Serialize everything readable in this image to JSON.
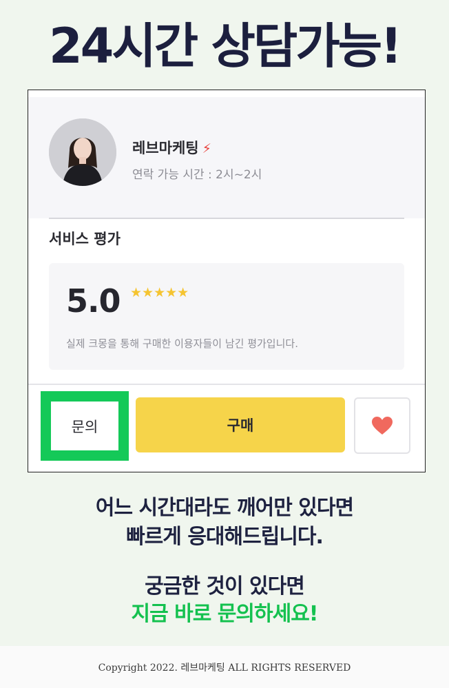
{
  "headline": "24시간 상담가능!",
  "seller": {
    "name": "레브마케팅",
    "badge_icon": "lightning-bolt-icon",
    "contact_time": "연락 가능 시간 : 2시~2시"
  },
  "rating": {
    "title": "서비스 평가",
    "score": "5.0",
    "stars": "★★★★★",
    "description": "실제 크몽을 통해 구매한 이용자들이 남긴 평가입니다."
  },
  "actions": {
    "inquiry_label": "문의",
    "buy_label": "구매",
    "like_icon": "heart-icon"
  },
  "message": {
    "line1": "어느 시간대라도 깨어만 있다면",
    "line2": "빠르게 응대해드립니다.",
    "line3": "궁금한 것이 있다면",
    "line4": "지금 바로 문의하세요!"
  },
  "footer": {
    "copyright": "Copyright 2022. 레브마케팅 ALL RIGHTS RESERVED"
  },
  "colors": {
    "highlight_green": "#14c958",
    "buy_yellow": "#f6d44a",
    "heart_red": "#f0695e",
    "star_yellow": "#f5c431"
  }
}
